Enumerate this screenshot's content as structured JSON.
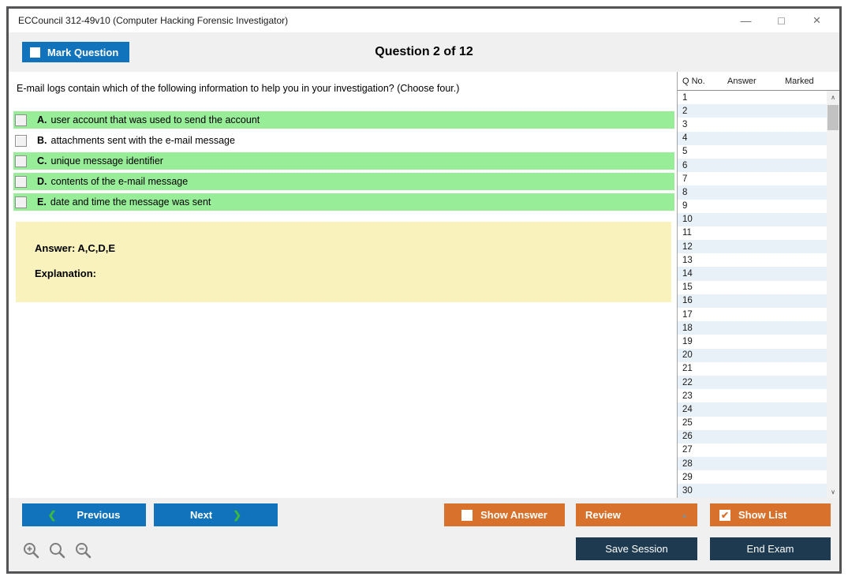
{
  "window": {
    "title": "ECCouncil 312-49v10 (Computer Hacking Forensic Investigator)",
    "controls": {
      "minimize_glyph": "—",
      "maximize_glyph": "□",
      "close_glyph": "×"
    }
  },
  "header": {
    "mark_question_label": "Mark Question",
    "mark_question_checked": false,
    "question_counter": "Question 2 of 12"
  },
  "question": {
    "text": "E-mail logs contain which of the following information to help you in your investigation? (Choose four.)",
    "options": [
      {
        "letter": "A.",
        "text": "user account that was used to send the account",
        "highlighted": true,
        "checked": false
      },
      {
        "letter": "B.",
        "text": "attachments sent with the e-mail message",
        "highlighted": false,
        "checked": false
      },
      {
        "letter": "C.",
        "text": "unique message identifier",
        "highlighted": true,
        "checked": false
      },
      {
        "letter": "D.",
        "text": "contents of the e-mail message",
        "highlighted": true,
        "checked": false
      },
      {
        "letter": "E.",
        "text": "date and time the message was sent",
        "highlighted": true,
        "checked": false
      }
    ],
    "answer_label": "Answer: A,C,D,E",
    "explanation_label": "Explanation:"
  },
  "question_list": {
    "columns": [
      "Q No.",
      "Answer",
      "Marked"
    ],
    "rows": [
      "1",
      "2",
      "3",
      "4",
      "5",
      "6",
      "7",
      "8",
      "9",
      "10",
      "11",
      "12",
      "13",
      "14",
      "15",
      "16",
      "17",
      "18",
      "19",
      "20",
      "21",
      "22",
      "23",
      "24",
      "25",
      "26",
      "27",
      "28",
      "29",
      "30"
    ],
    "scrollbar": {
      "up_glyph": "∧",
      "down_glyph": "∨"
    }
  },
  "footer": {
    "previous_label": "Previous",
    "next_label": "Next",
    "chevron_left_glyph": "❮",
    "chevron_right_glyph": "❯",
    "show_answer_label": "Show Answer",
    "show_answer_checked": false,
    "review_label": "Review",
    "review_caret_glyph": "▲",
    "show_list_label": "Show List",
    "show_list_checked": true,
    "show_list_check_glyph": "✔",
    "save_session_label": "Save Session",
    "end_exam_label": "End Exam",
    "zoom_icons": [
      "zoom-in-icon",
      "zoom-icon",
      "zoom-out-icon"
    ]
  },
  "colors": {
    "blue": "#1173BB",
    "orange": "#D7712B",
    "navy": "#1D3A50",
    "chevron_green": "#3CB83C",
    "option_green": "#98EE98",
    "answer_yellow": "#FAF2BC",
    "alt_row_blue": "#E9F1F8"
  }
}
